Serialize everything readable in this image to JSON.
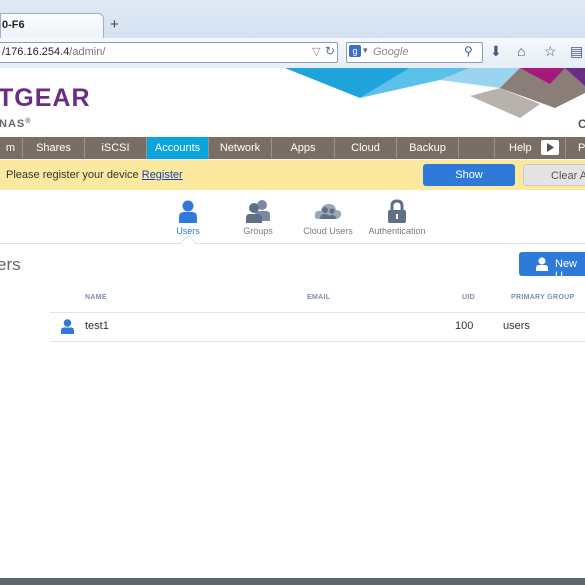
{
  "browser": {
    "tab_title": "0-F6",
    "new_tab_symbol": "+",
    "url_host": "/176.16.254.4",
    "url_path": "/admin/",
    "search_engine_symbol": "g",
    "search_placeholder": "Google"
  },
  "brand": {
    "logo": "TGEAR",
    "logo_sub": "NAS",
    "edge_letter": "C",
    "colors": {
      "purple": "#6b2c84",
      "cyan": "#0aa5dd",
      "gray_nav": "#7a6e64"
    }
  },
  "nav": {
    "tabs": [
      {
        "label": "m"
      },
      {
        "label": "Shares"
      },
      {
        "label": "iSCSI"
      },
      {
        "label": "Accounts",
        "active": true
      },
      {
        "label": "Network"
      },
      {
        "label": "Apps"
      },
      {
        "label": "Cloud"
      },
      {
        "label": "Backup"
      },
      {
        "label": ""
      },
      {
        "label": "Help"
      },
      {
        "label": "P"
      }
    ]
  },
  "register": {
    "text": "Please register your device",
    "link": "Register",
    "show_label": "Show",
    "clear_label": "Clear Al"
  },
  "subnav": {
    "items": [
      {
        "label": "Users",
        "icon": "user-icon",
        "active": true
      },
      {
        "label": "Groups",
        "icon": "groups-icon"
      },
      {
        "label": "Cloud Users",
        "icon": "cloud-users-icon"
      },
      {
        "label": "Authentication",
        "icon": "lock-icon"
      }
    ]
  },
  "page": {
    "title": "ers",
    "new_user_label": "New U"
  },
  "table": {
    "columns": [
      "NAME",
      "EMAIL",
      "UID",
      "PRIMARY GROUP"
    ],
    "rows": [
      {
        "name": "test1",
        "email": "",
        "uid": "100",
        "group": "users"
      }
    ]
  }
}
